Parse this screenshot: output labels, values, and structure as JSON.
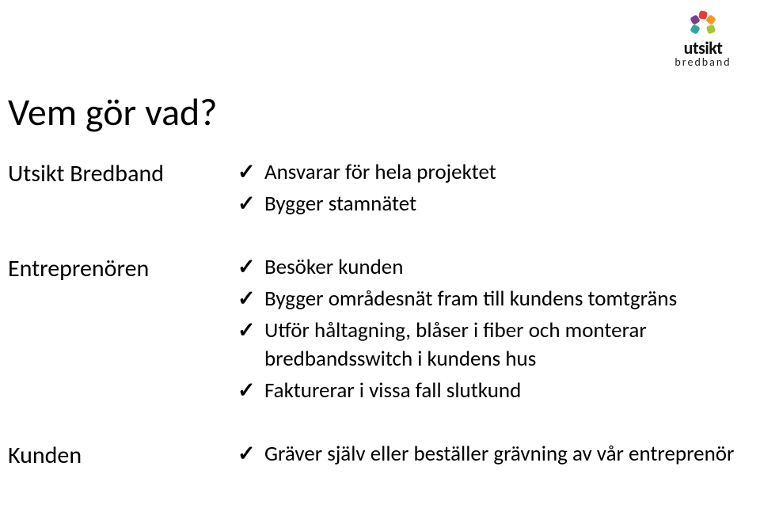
{
  "logo": {
    "wordmark": "utsikt",
    "sub": "bredband",
    "colors": {
      "red": "#e63b2e",
      "orange": "#f29a1f",
      "green": "#a7c539",
      "purple": "#7a3e8f",
      "teal": "#2aa8a0"
    }
  },
  "title": "Vem gör vad?",
  "sections": [
    {
      "label": "Utsikt Bredband",
      "items": [
        "Ansvarar för hela projektet",
        "Bygger stamnätet"
      ]
    },
    {
      "label": "Entreprenören",
      "items": [
        "Besöker kunden",
        "Bygger områdesnät fram till kundens tomtgräns",
        "Utför håltagning, blåser i fiber och monterar bredbandsswitch i kundens hus",
        "Fakturerar i vissa fall slutkund"
      ]
    },
    {
      "label": "Kunden",
      "items": [
        "Gräver själv eller beställer grävning av vår entreprenör"
      ]
    }
  ],
  "checkmark": "✓"
}
